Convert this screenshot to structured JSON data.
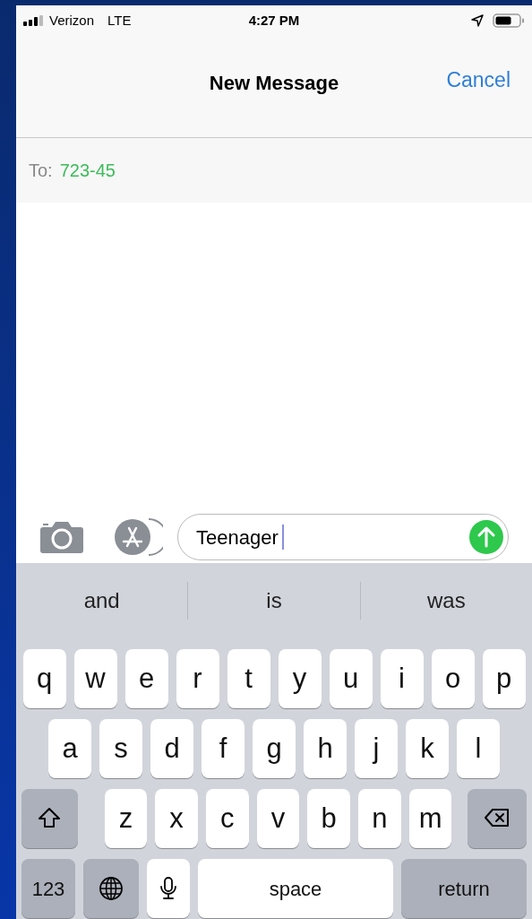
{
  "status_bar": {
    "carrier": "Verizon",
    "network": "LTE",
    "time": "4:27 PM"
  },
  "nav": {
    "title": "New Message",
    "cancel": "Cancel"
  },
  "to": {
    "label": "To:",
    "value": "723-45"
  },
  "compose": {
    "value": "Teenager"
  },
  "suggestions": [
    "and",
    "is",
    "was"
  ],
  "keyboard": [
    [
      {
        "kind": "letter",
        "label": "q"
      },
      {
        "kind": "letter",
        "label": "w"
      },
      {
        "kind": "letter",
        "label": "e"
      },
      {
        "kind": "letter",
        "label": "r"
      },
      {
        "kind": "letter",
        "label": "t"
      },
      {
        "kind": "letter",
        "label": "y"
      },
      {
        "kind": "letter",
        "label": "u"
      },
      {
        "kind": "letter",
        "label": "i"
      },
      {
        "kind": "letter",
        "label": "o"
      },
      {
        "kind": "letter",
        "label": "p"
      }
    ],
    [
      {
        "kind": "letter",
        "label": "a"
      },
      {
        "kind": "letter",
        "label": "s"
      },
      {
        "kind": "letter",
        "label": "d"
      },
      {
        "kind": "letter",
        "label": "f"
      },
      {
        "kind": "letter",
        "label": "g"
      },
      {
        "kind": "letter",
        "label": "h"
      },
      {
        "kind": "letter",
        "label": "j"
      },
      {
        "kind": "letter",
        "label": "k"
      },
      {
        "kind": "letter",
        "label": "l"
      }
    ],
    [
      {
        "kind": "shift"
      },
      {
        "kind": "letter",
        "label": "z"
      },
      {
        "kind": "letter",
        "label": "x"
      },
      {
        "kind": "letter",
        "label": "c"
      },
      {
        "kind": "letter",
        "label": "v"
      },
      {
        "kind": "letter",
        "label": "b"
      },
      {
        "kind": "letter",
        "label": "n"
      },
      {
        "kind": "letter",
        "label": "m"
      },
      {
        "kind": "delete"
      }
    ],
    [
      {
        "kind": "numbers",
        "label": "123"
      },
      {
        "kind": "globe"
      },
      {
        "kind": "mic"
      },
      {
        "kind": "space",
        "label": "space"
      },
      {
        "kind": "return",
        "label": "return"
      }
    ]
  ]
}
